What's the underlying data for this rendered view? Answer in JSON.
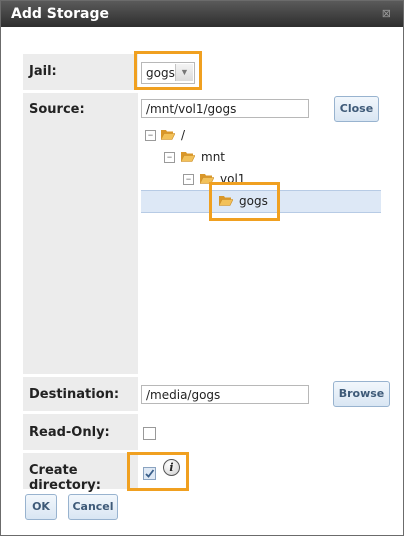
{
  "window": {
    "title": "Add Storage",
    "close_glyph": "⊠"
  },
  "form": {
    "jail": {
      "label": "Jail:",
      "selected": "gogs"
    },
    "source": {
      "label": "Source:",
      "value": "/mnt/vol1/gogs",
      "close_button": "Close",
      "tree": [
        {
          "label": "/",
          "toggle": "−"
        },
        {
          "label": "mnt",
          "toggle": "−"
        },
        {
          "label": "vol1",
          "toggle": "−"
        },
        {
          "label": "gogs",
          "selected": true
        }
      ]
    },
    "destination": {
      "label": "Destination:",
      "value": "/media/gogs",
      "browse_button": "Browse"
    },
    "read_only": {
      "label": "Read-Only:",
      "checked": false
    },
    "create_directory": {
      "label": "Create directory:",
      "checked": true,
      "info_glyph": "i"
    }
  },
  "footer": {
    "ok": "OK",
    "cancel": "Cancel"
  },
  "colors": {
    "highlight": "#f0a020",
    "label_bg": "#ececec",
    "button_text": "#3e5a78",
    "folder": "#e8a93a"
  }
}
